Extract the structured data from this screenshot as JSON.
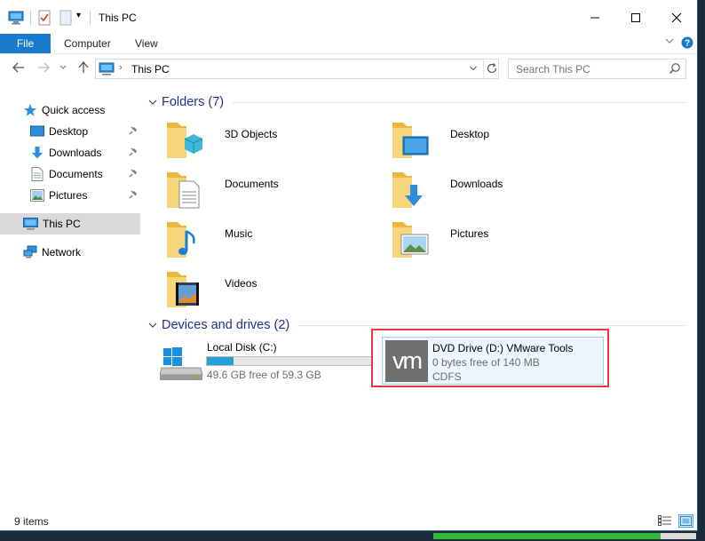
{
  "window": {
    "title": "This PC"
  },
  "ribbon": {
    "tabs": [
      "File",
      "Computer",
      "View"
    ]
  },
  "address": {
    "path": "This PC"
  },
  "search": {
    "placeholder": "Search This PC"
  },
  "sidebar": {
    "items": [
      {
        "label": "Quick access",
        "icon": "star-icon"
      },
      {
        "label": "Desktop",
        "icon": "desktop-icon",
        "pinned": true
      },
      {
        "label": "Downloads",
        "icon": "download-arrow-icon",
        "pinned": true
      },
      {
        "label": "Documents",
        "icon": "document-icon",
        "pinned": true
      },
      {
        "label": "Pictures",
        "icon": "pictures-icon",
        "pinned": true
      },
      {
        "label": "This PC",
        "icon": "computer-icon",
        "selected": true
      },
      {
        "label": "Network",
        "icon": "network-icon"
      }
    ]
  },
  "groups": {
    "folders": {
      "title": "Folders (7)",
      "items": [
        {
          "label": "3D Objects",
          "icon": "3d-objects-icon"
        },
        {
          "label": "Desktop",
          "icon": "desktop-folder-icon"
        },
        {
          "label": "Documents",
          "icon": "documents-folder-icon"
        },
        {
          "label": "Downloads",
          "icon": "downloads-folder-icon"
        },
        {
          "label": "Music",
          "icon": "music-folder-icon"
        },
        {
          "label": "Pictures",
          "icon": "pictures-folder-icon"
        },
        {
          "label": "Videos",
          "icon": "videos-folder-icon"
        }
      ]
    },
    "drives": {
      "title": "Devices and drives (2)",
      "items": [
        {
          "label": "Local Disk (C:)",
          "detail": "49.6 GB free of 59.3 GB",
          "used_fraction": 0.164,
          "icon": "windows-drive-icon"
        },
        {
          "label": "DVD Drive (D:) VMware Tools",
          "detail": "0 bytes free of 140 MB",
          "filesystem": "CDFS",
          "icon": "vmware-icon",
          "logo_text": "vm",
          "highlighted": true
        }
      ]
    }
  },
  "status": {
    "items_count": "9 items"
  },
  "colors": {
    "accent": "#1979ca",
    "group_title": "#1e3287",
    "highlight_box": "#e0393e",
    "drive_bar": "#26a0da"
  }
}
